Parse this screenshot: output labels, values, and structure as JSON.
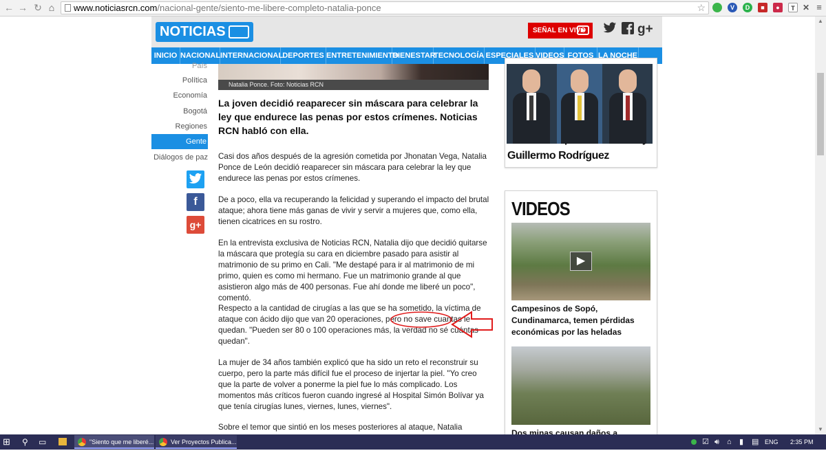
{
  "browser": {
    "url_host": "www.noticiasrcn.com",
    "url_path": "/nacional-gente/siento-me-libere-completo-natalia-ponce"
  },
  "header": {
    "logo_text": "NOTICIAS",
    "live_label": "SEÑAL EN VIVO",
    "social": [
      "twitter-icon",
      "facebook-icon",
      "google-plus-icon"
    ]
  },
  "menu": [
    "INICIO",
    "NACIONAL",
    "INTERNACIONAL",
    "DEPORTES",
    "ENTRETENIMIENTO",
    "BIENESTAR",
    "TECNOLOGÍA",
    "ESPECIALES",
    "VIDEOS",
    "FOTOS",
    "LA NOCHE"
  ],
  "subnav": {
    "items": [
      "País",
      "Política",
      "Economía",
      "Bogotá",
      "Regiones",
      "Gente",
      "Diálogos de paz"
    ],
    "active": "Gente"
  },
  "article": {
    "photo_caption": "Natalia Ponce. Foto: Noticias RCN",
    "lead": "La joven decidió reaparecer sin máscara para celebrar la ley que endurece las penas por estos crímenes. Noticias RCN habló con ella.",
    "paragraphs": [
      "Casi dos años después de la agresión cometida por Jhonatan Vega, Natalia Ponce de León decidió reaparecer sin máscara para celebrar la ley que endurece las penas por estos crímenes.",
      "De a poco, ella va recuperando la felicidad y superando el impacto del brutal ataque; ahora tiene más ganas de vivir y servir a mujeres que, como ella, tienen cicatrices en su rostro.",
      "En la entrevista exclusiva de Noticias RCN, Natalia dijo que decidió quitarse la máscara que protegía su cara en diciembre pasado para asistir al matrimonio de su primo en Cali. \"Me destapé para ir al matrimonio de mi primo, quien es como mi hermano. Fue un matrimonio grande al que asistieron algo más de 400 personas. Fue ahí donde me liberé un poco\", comentó.",
      "Respecto a la cantidad de cirugías a las que se ha sometido, la víctima de ataque con ácido dijo que van 20 operaciones, pero no save cuantas le quedan. \"Pueden ser 80 o 100 operaciones más, la verdad no sé cuántas quedan\".",
      "La mujer de 34 años también explicó que ha sido un reto el reconstruir su cuerpo, pero la parte más difícil fue el proceso de injertar la piel. \"Yo creo que la parte de volver a ponerme la piel fue lo más complicado. Los momentos más críticos fueron cuando ingresé al Hospital Simón Bolívar ya que tenía cirugías lunes, viernes, lunes, viernes\".",
      "Sobre el temor que sintió en los meses posteriores al ataque, Natalia aseguró"
    ]
  },
  "sidebar": {
    "story_title": "Sí o No: responden Vladdo y Guillermo Rodríguez",
    "videos_title": "VIDEOS",
    "video1_title": "Campesinos de Sopó, Cundinamarca, temen pérdidas económicas por las heladas",
    "video2_title": "Dos minas causan daños a páramos de"
  },
  "taskbar": {
    "items": [
      "\"Siento que me liberé...",
      "Ver Proyectos Publica..."
    ],
    "lang": "ENG",
    "time": "2:35 PM"
  },
  "colors": {
    "brand_blue": "#1b8fe3",
    "live_red": "#dd0000",
    "annotation_red": "#e01b1b"
  }
}
